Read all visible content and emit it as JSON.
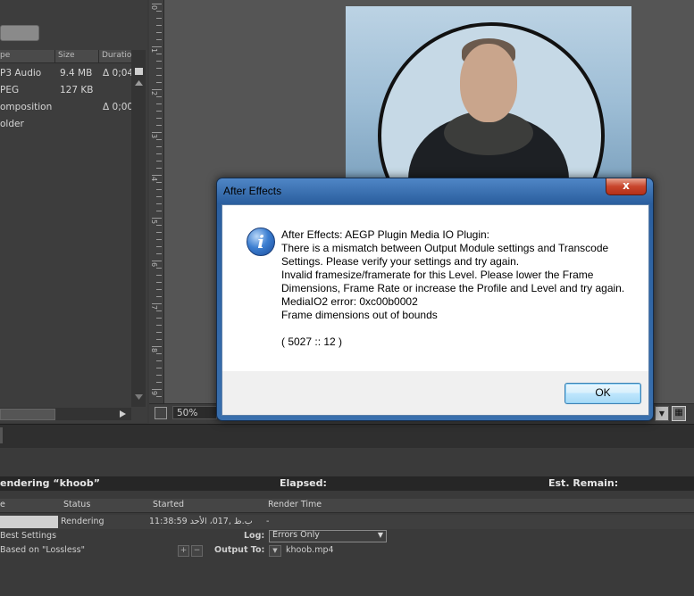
{
  "project": {
    "columns": {
      "type": "pe",
      "size": "Size",
      "duration": "Duration"
    },
    "rows": [
      {
        "type": "P3 Audio",
        "size": "9.4 MB",
        "duration": "Δ 0;04"
      },
      {
        "type": "PEG",
        "size": "127 KB",
        "duration": ""
      },
      {
        "type": "omposition",
        "size": "",
        "duration": "Δ 0;00"
      },
      {
        "type": "older",
        "size": "",
        "duration": ""
      }
    ]
  },
  "ruler": {
    "labels": [
      "0",
      "1",
      "2",
      "3",
      "4",
      "5",
      "6",
      "7",
      "8",
      "9"
    ]
  },
  "viewer": {
    "zoom": "50%",
    "drop_icon": "chevron-down-icon"
  },
  "dialog": {
    "title": "After Effects",
    "close_label": "x",
    "icon": "i",
    "lines": [
      "After Effects: AEGP Plugin Media IO Plugin:",
      "There is a mismatch between Output Module settings and Transcode",
      "Settings. Please verify your settings and try again.",
      "Invalid framesize/framerate for this Level. Please lower the Frame",
      "Dimensions, Frame Rate or increase the Profile and Level and try again.",
      "MediaIO2 error: 0xc00b0002",
      "Frame dimensions out of bounds",
      "",
      "( 5027 :: 12 )"
    ],
    "ok_label": "OK"
  },
  "render_queue": {
    "title": "endering “khoob”",
    "elapsed_label": "Elapsed:",
    "remain_label": "Est. Remain:",
    "columns": {
      "name": "e",
      "status": "Status",
      "started": "Started",
      "render_time": "Render Time"
    },
    "item": {
      "status": "Rendering",
      "started": "11:38:59 ب.ظ ,017، الأحد",
      "render_time": "-"
    },
    "render_settings": "Best Settings",
    "log_label": "Log:",
    "log_value": "Errors Only",
    "output_module": "Based on \"Lossless\"",
    "output_to_label": "Output To:",
    "output_file": "khoob.mp4"
  }
}
